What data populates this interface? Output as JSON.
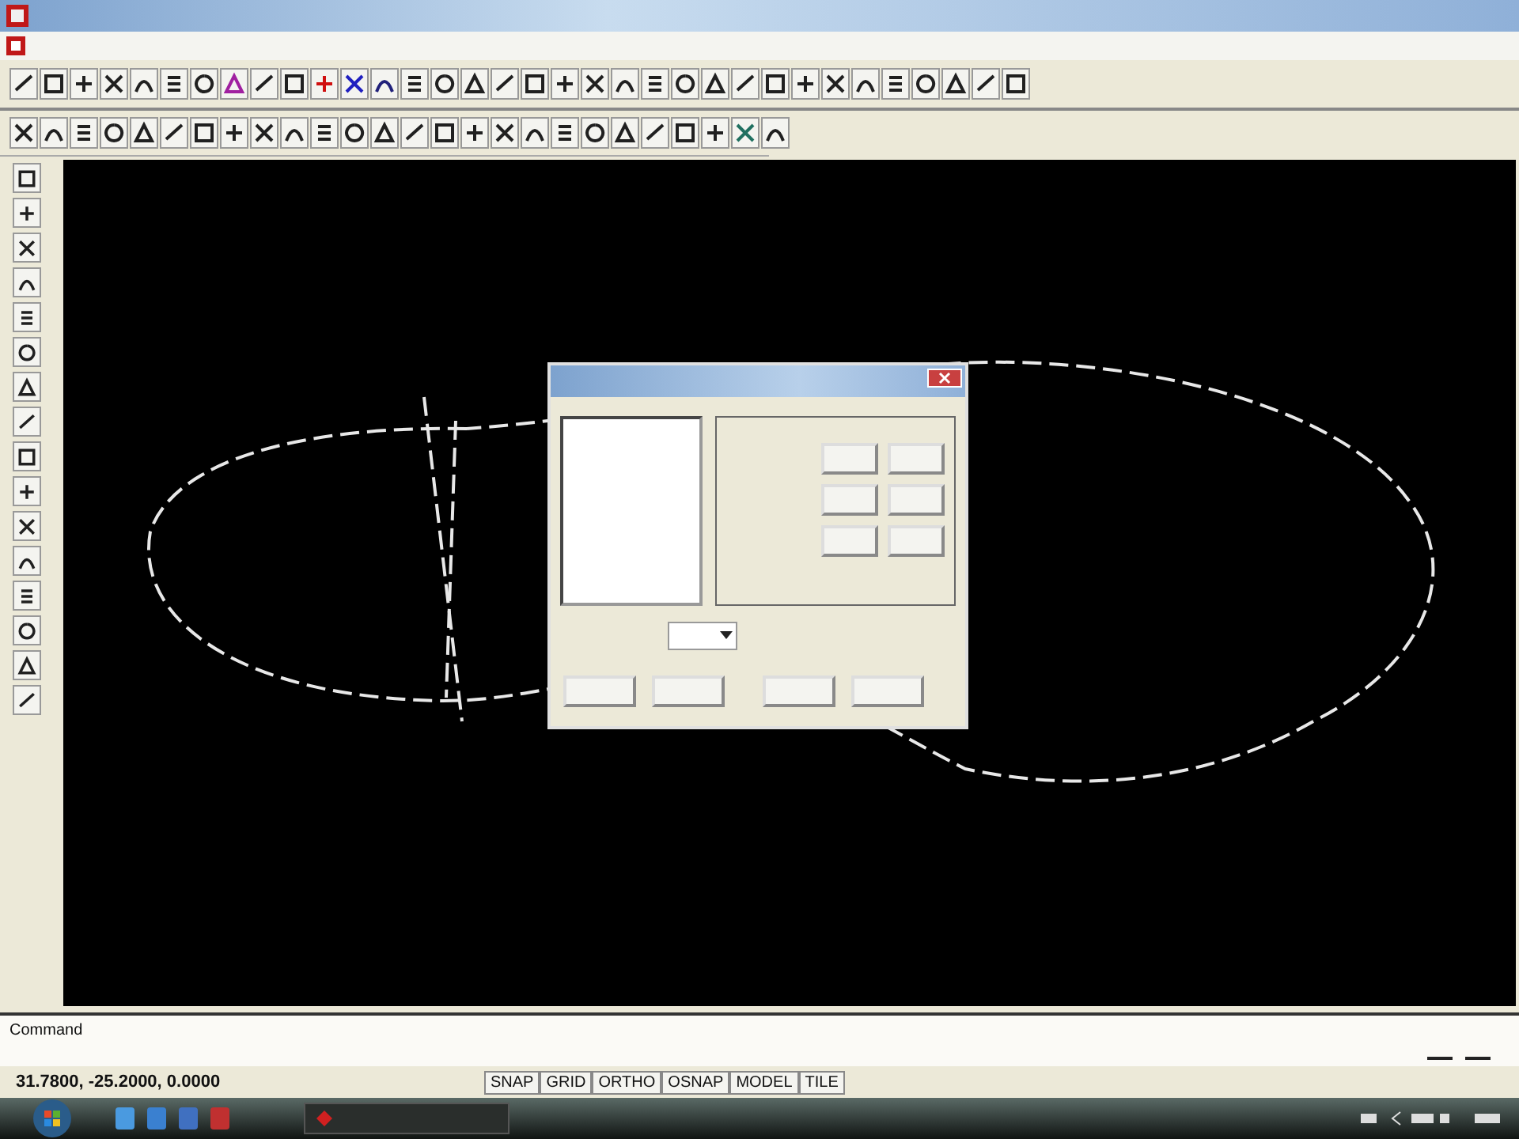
{
  "command_line": {
    "prompt": "Command"
  },
  "status_bar": {
    "coordinates": "31.7800, -25.2000, 0.0000",
    "toggles": [
      {
        "label": "SNAP"
      },
      {
        "label": "GRID"
      },
      {
        "label": "ORTHO"
      },
      {
        "label": "OSNAP"
      },
      {
        "label": "MODEL"
      },
      {
        "label": "TILE"
      }
    ]
  }
}
